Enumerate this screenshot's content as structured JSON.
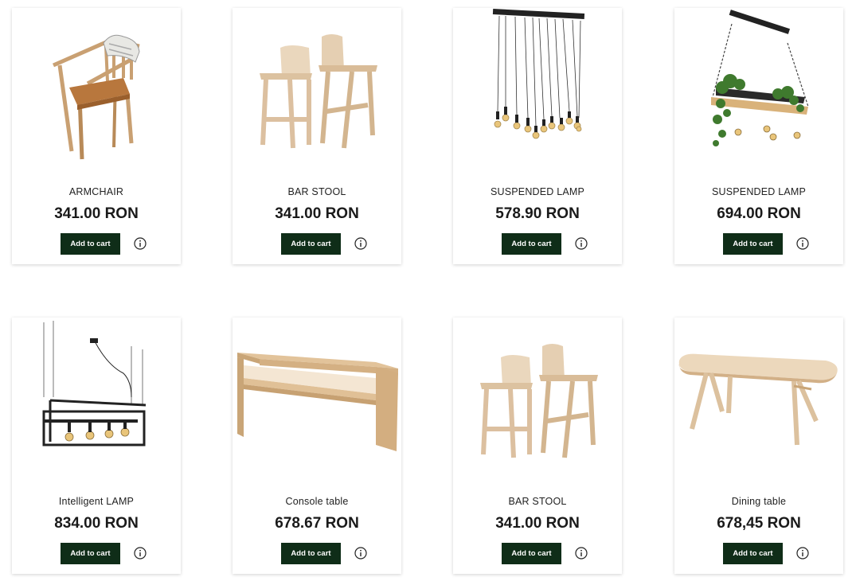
{
  "products": [
    {
      "name": "ARMCHAIR",
      "price": "341.00 RON",
      "cta": "Add to cart",
      "image_icon": "armchair-image"
    },
    {
      "name": "BAR STOOL",
      "price": "341.00 RON",
      "cta": "Add to cart",
      "image_icon": "bar-stool-image"
    },
    {
      "name": "SUSPENDED LAMP",
      "price": "578.90 RON",
      "cta": "Add to cart",
      "image_icon": "pendant-lamp-image"
    },
    {
      "name": "SUSPENDED LAMP",
      "price": "694.00 RON",
      "cta": "Add to cart",
      "image_icon": "planter-lamp-image"
    },
    {
      "name": "Intelligent LAMP",
      "price": "834.00 RON",
      "cta": "Add to cart",
      "image_icon": "frame-lamp-image"
    },
    {
      "name": "Console table",
      "price": "678.67 RON",
      "cta": "Add to cart",
      "image_icon": "console-table-image"
    },
    {
      "name": "BAR STOOL",
      "price": "341.00 RON",
      "cta": "Add to cart",
      "image_icon": "bar-stool-image"
    },
    {
      "name": "Dining table",
      "price": "678,45 RON",
      "cta": "Add to cart",
      "image_icon": "dining-table-image"
    }
  ],
  "colors": {
    "button_bg": "#0f2d18",
    "button_text": "#ffffff",
    "wood": "#d9b88f",
    "metal": "#222222"
  },
  "icons": {
    "info": "info-circle-icon"
  }
}
